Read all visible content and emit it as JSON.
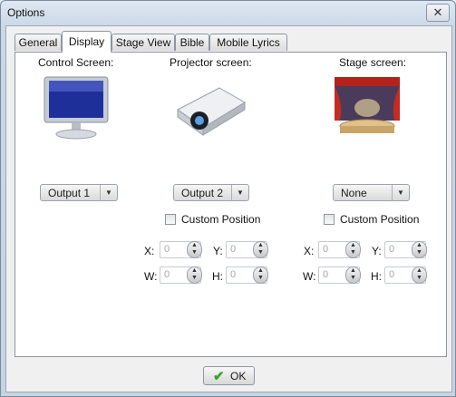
{
  "window": {
    "title": "Options",
    "close_glyph": "✕"
  },
  "tabs": [
    {
      "label": "General"
    },
    {
      "label": "Display"
    },
    {
      "label": "Stage View"
    },
    {
      "label": "Bible"
    },
    {
      "label": "Mobile Lyrics"
    }
  ],
  "active_tab": "Display",
  "control": {
    "heading": "Control Screen:",
    "select_value": "Output 1"
  },
  "projector": {
    "heading": "Projector screen:",
    "select_value": "Output 2",
    "custom_label": "Custom Position",
    "x_label": "X:",
    "y_label": "Y:",
    "w_label": "W:",
    "h_label": "H:",
    "x": "0",
    "y": "0",
    "w": "0",
    "h": "0"
  },
  "stage": {
    "heading": "Stage screen:",
    "select_value": "None",
    "custom_label": "Custom Position",
    "x_label": "X:",
    "y_label": "Y:",
    "w_label": "W:",
    "h_label": "H:",
    "x": "0",
    "y": "0",
    "w": "0",
    "h": "0"
  },
  "ok_label": "OK",
  "icons": {
    "monitor": "monitor-icon",
    "projector": "projector-icon",
    "stage": "stage-icon",
    "ok": "checkmark-icon"
  },
  "colors": {
    "accent": "#1f2f9a",
    "ok_check": "#3aa12e",
    "curtain": "#b3231c"
  }
}
